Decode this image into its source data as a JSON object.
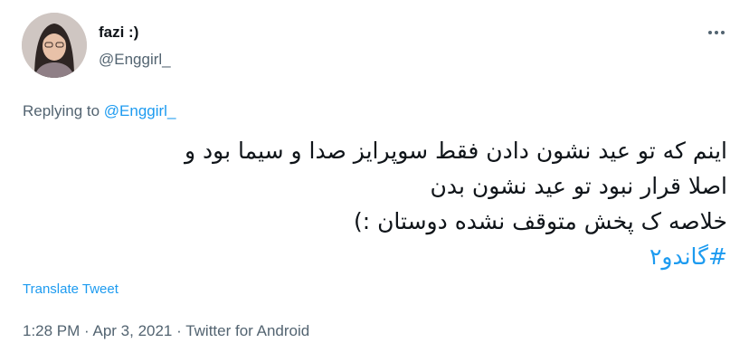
{
  "author": {
    "display_name": "fazi :)",
    "handle": "@Enggirl_"
  },
  "reply": {
    "prefix": "Replying to ",
    "to_handle": "@Enggirl_"
  },
  "tweet": {
    "lines": [
      "اینم که تو عید نشون دادن فقط سوپرایز صدا و سیما بود و",
      "اصلا قرار نبود تو عید نشون بدن",
      "خلاصه ک پخش متوقف نشده دوستان :)"
    ],
    "hashtag": "#گاندو۲"
  },
  "actions": {
    "translate_label": "Translate Tweet",
    "more_icon": "more-options-icon"
  },
  "meta": {
    "time": "1:28 PM",
    "separator1": " · ",
    "date": "Apr 3, 2021",
    "separator2": " · ",
    "source": "Twitter for Android"
  },
  "colors": {
    "accent": "#1d9bf0",
    "secondary_text": "#536471",
    "primary_text": "#0f1419"
  }
}
